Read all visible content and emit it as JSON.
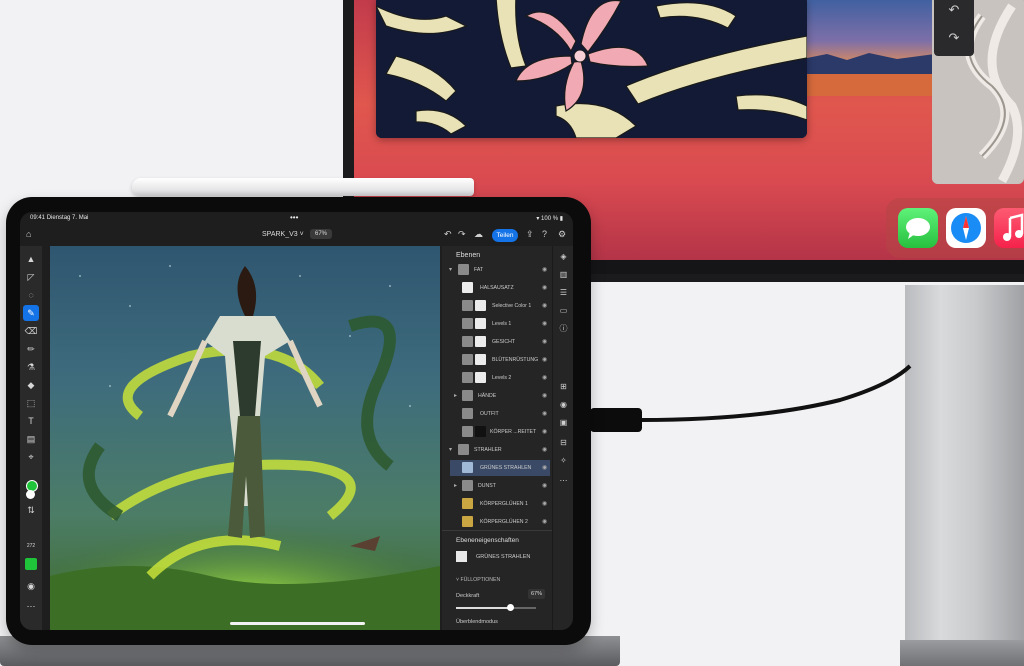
{
  "colors": {
    "accent": "#1473e6",
    "panel": "#252525",
    "foreground_swatch": "#1fc43a",
    "background_swatch": "#ffffff"
  },
  "monitor": {
    "dock_apps": [
      "messages-icon",
      "safari-icon",
      "music-icon"
    ],
    "side_controls": [
      "↶",
      "↷"
    ]
  },
  "ipad": {
    "status": {
      "time": "09:41",
      "date": "Dienstag 7. Mai",
      "dots": "•••",
      "battery": "100 %"
    },
    "app": {
      "document_title": "SPARK_V3 ˅",
      "zoom": "67%",
      "share_label": "Teilen"
    },
    "tools": [
      "▲",
      "◸",
      "◌",
      "✎",
      "⌫",
      "✏",
      "⚗",
      "◆",
      "⬚",
      "T",
      "▤",
      "⌖",
      "⇅"
    ],
    "brush_size": "272",
    "layers_panel": {
      "title": "Ebenen",
      "layers": [
        {
          "name": "FAT",
          "group": true
        },
        {
          "name": "HALSAUSATZ",
          "group": false
        },
        {
          "name": "Selective Color 1",
          "group": false
        },
        {
          "name": "Levels 1",
          "group": false
        },
        {
          "name": "GESICHT",
          "group": false
        },
        {
          "name": "BLÜTENRÜSTUNG",
          "group": false
        },
        {
          "name": "Levels 2",
          "group": false
        },
        {
          "name": "HÄNDE",
          "group": true
        },
        {
          "name": "OUTFIT",
          "group": false
        },
        {
          "name": "KÖRPER ...REITET",
          "group": false
        },
        {
          "name": "STRAHLER",
          "group": true
        },
        {
          "name": "GRÜNES STRAHLEN",
          "group": false,
          "selected": true
        },
        {
          "name": "DUNST",
          "group": true
        },
        {
          "name": "KÖRPERGLÜHEN 1",
          "group": false
        },
        {
          "name": "KÖRPERGLÜHEN 2",
          "group": false
        }
      ]
    },
    "properties": {
      "title": "Ebeneneigenschaften",
      "layer_name": "GRÜNES STRAHLEN",
      "section": "FÜLLOPTIONEN",
      "opacity_label": "Deckkraft",
      "opacity_value": "67%",
      "opacity_fraction": 0.67,
      "blend_label": "Überblendmodus"
    }
  }
}
